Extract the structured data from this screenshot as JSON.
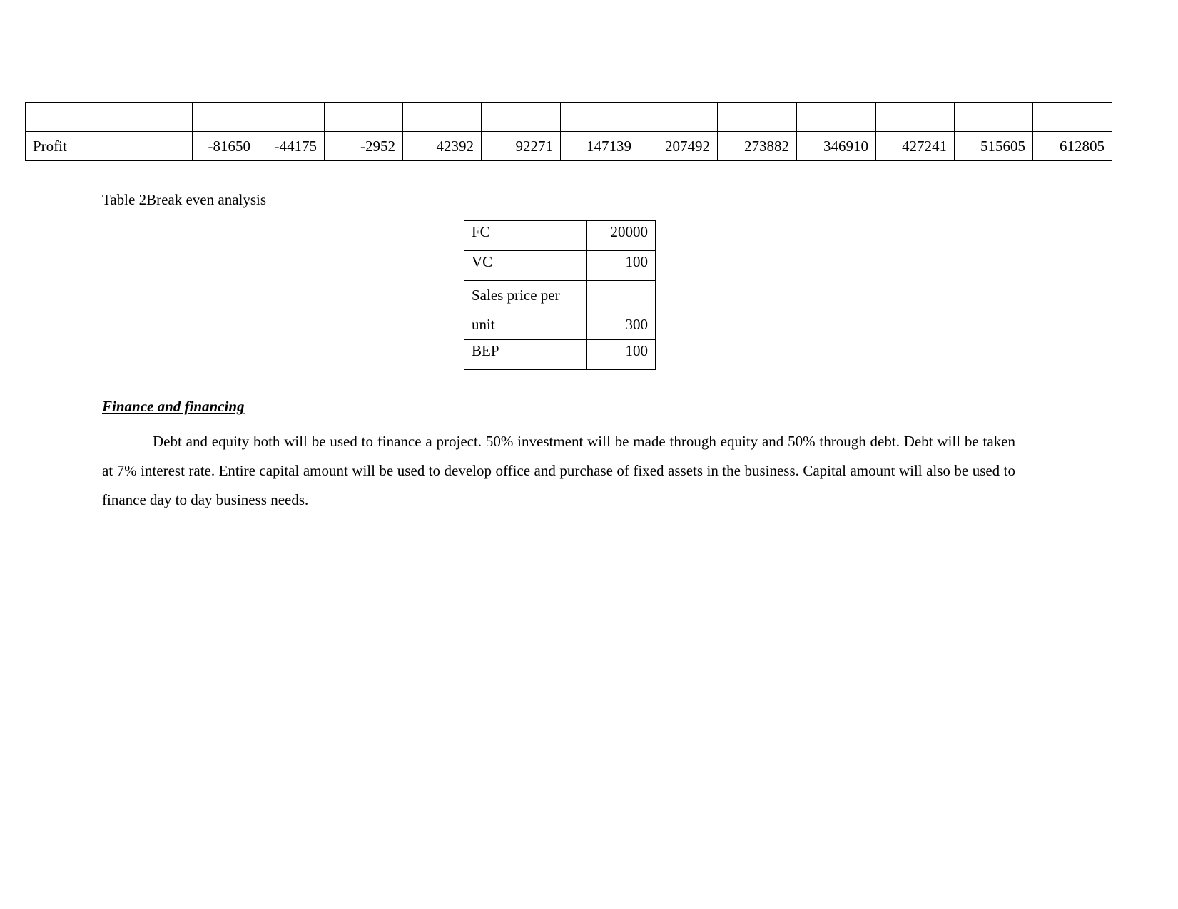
{
  "profit_table": {
    "header_row": [
      "",
      "",
      "",
      "",
      "",
      "",
      "",
      "",
      "",
      "",
      "",
      "",
      ""
    ],
    "profit_row": {
      "label": "Profit",
      "values": [
        "-81650",
        "-44175",
        "-2952",
        "42392",
        "92271",
        "147139",
        "207492",
        "273882",
        "346910",
        "427241",
        "515605",
        "612805"
      ]
    }
  },
  "bep_caption": "Table 2Break even analysis",
  "bep_table": [
    {
      "label": "FC",
      "value": "20000"
    },
    {
      "label": "VC",
      "value": "100"
    },
    {
      "label": "Sales price per unit",
      "value": "300"
    },
    {
      "label": "BEP",
      "value": "100"
    }
  ],
  "section": {
    "heading": "Finance and financing",
    "paragraph": "Debt and equity both will be used to finance a project. 50% investment will be made through equity and 50% through debt. Debt will be taken at 7% interest rate. Entire capital amount will be used to develop office and purchase of fixed assets in the business. Capital amount will also be used to finance day to day business needs."
  }
}
